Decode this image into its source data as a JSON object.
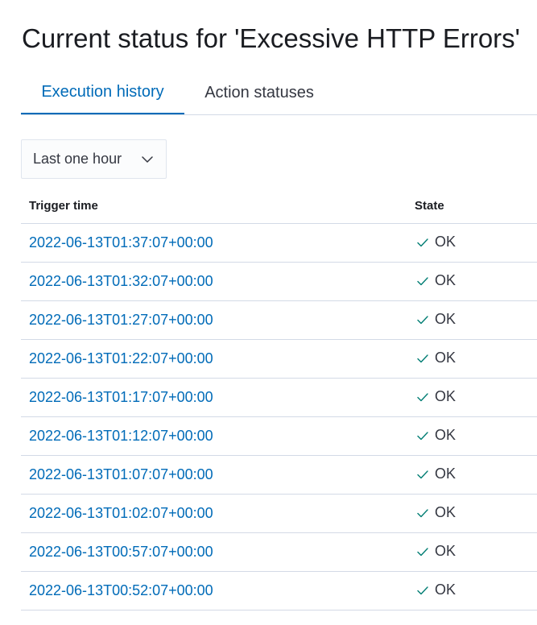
{
  "header": {
    "title": "Current status for 'Excessive HTTP Errors'"
  },
  "tabs": [
    {
      "label": "Execution history",
      "active": true
    },
    {
      "label": "Action statuses",
      "active": false
    }
  ],
  "time_filter": {
    "selected": "Last one hour",
    "icon": "chevron-down-icon"
  },
  "table": {
    "columns": [
      "Trigger time",
      "State"
    ],
    "rows": [
      {
        "trigger_time": "2022-06-13T01:37:07+00:00",
        "state": "OK"
      },
      {
        "trigger_time": "2022-06-13T01:32:07+00:00",
        "state": "OK"
      },
      {
        "trigger_time": "2022-06-13T01:27:07+00:00",
        "state": "OK"
      },
      {
        "trigger_time": "2022-06-13T01:22:07+00:00",
        "state": "OK"
      },
      {
        "trigger_time": "2022-06-13T01:17:07+00:00",
        "state": "OK"
      },
      {
        "trigger_time": "2022-06-13T01:12:07+00:00",
        "state": "OK"
      },
      {
        "trigger_time": "2022-06-13T01:07:07+00:00",
        "state": "OK"
      },
      {
        "trigger_time": "2022-06-13T01:02:07+00:00",
        "state": "OK"
      },
      {
        "trigger_time": "2022-06-13T00:57:07+00:00",
        "state": "OK"
      },
      {
        "trigger_time": "2022-06-13T00:52:07+00:00",
        "state": "OK"
      }
    ]
  },
  "colors": {
    "link": "#006bb8",
    "ok_check": "#017d73"
  }
}
